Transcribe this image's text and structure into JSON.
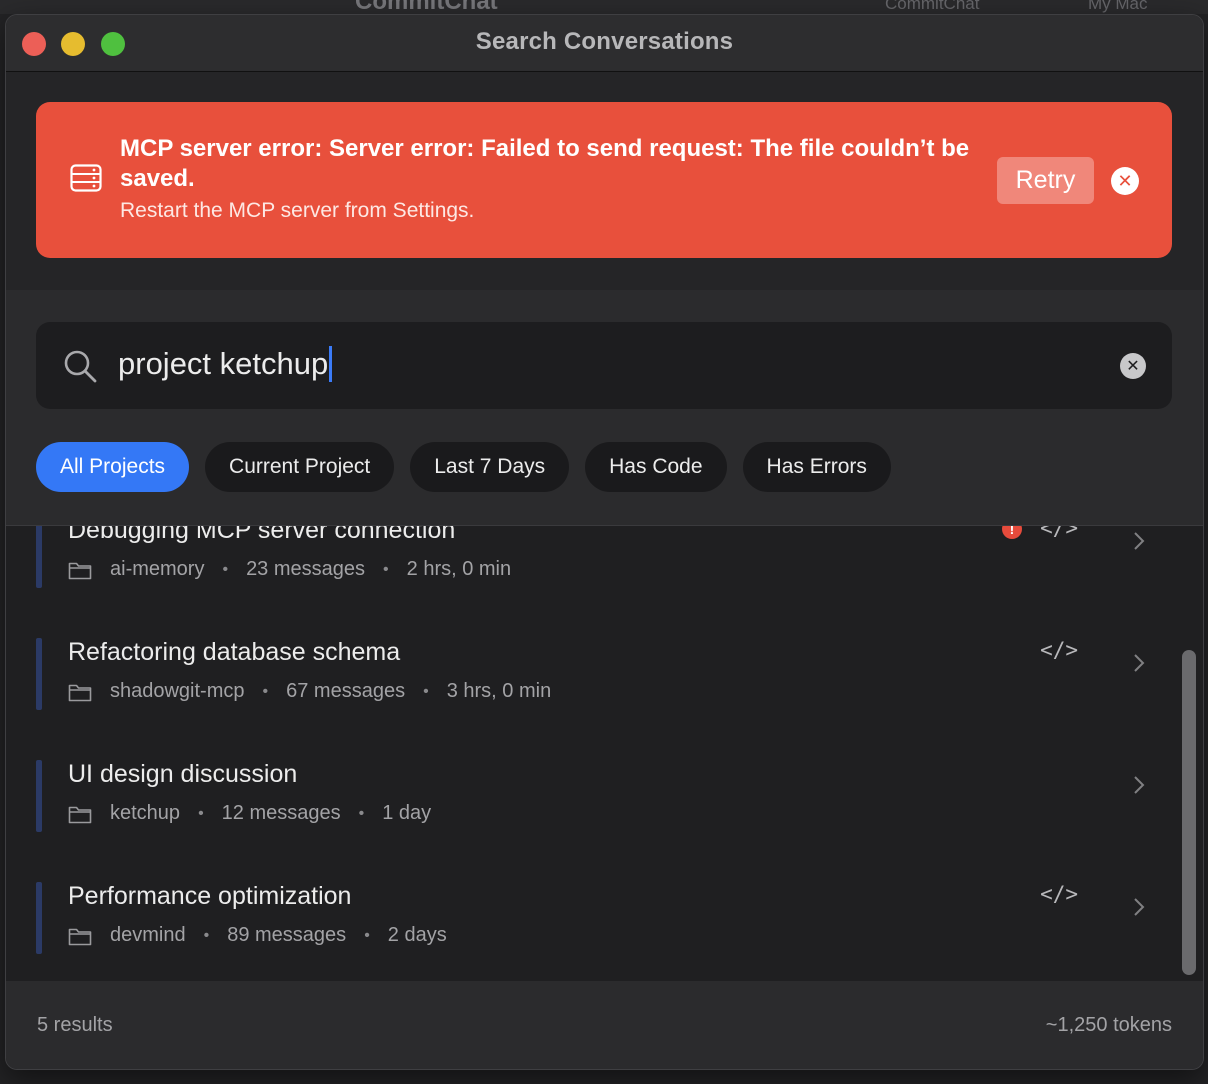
{
  "background": {
    "app_title": "CommitChat",
    "scheme": "CommitChat",
    "destination": "My Mac"
  },
  "window": {
    "title": "Search Conversations"
  },
  "error_banner": {
    "title": "MCP server error: Server error: Failed to send request: The file couldn’t be saved.",
    "subtitle": "Restart the MCP server from Settings.",
    "retry_label": "Retry",
    "icon": "server-icon",
    "color": "#e8503c"
  },
  "search": {
    "query": "project ketchup",
    "icon": "search-icon"
  },
  "filters": [
    {
      "label": "All Projects",
      "active": true
    },
    {
      "label": "Current Project",
      "active": false
    },
    {
      "label": "Last 7 Days",
      "active": false
    },
    {
      "label": "Has Code",
      "active": false
    },
    {
      "label": "Has Errors",
      "active": false
    }
  ],
  "results": [
    {
      "title": "Debugging MCP server connection",
      "project": "ai-memory",
      "messages": "23 messages",
      "duration": "2 hrs, 0 min",
      "has_error": true,
      "has_code": true
    },
    {
      "title": "Refactoring database schema",
      "project": "shadowgit-mcp",
      "messages": "67 messages",
      "duration": "3 hrs, 0 min",
      "has_error": false,
      "has_code": true
    },
    {
      "title": "UI design discussion",
      "project": "ketchup",
      "messages": "12 messages",
      "duration": "1 day",
      "has_error": false,
      "has_code": false
    },
    {
      "title": "Performance optimization",
      "project": "devmind",
      "messages": "89 messages",
      "duration": "2 days",
      "has_error": false,
      "has_code": true
    }
  ],
  "footer": {
    "count": "5 results",
    "tokens": "~1,250 tokens"
  },
  "colors": {
    "accent": "#3478f6",
    "error": "#e64b3c"
  }
}
